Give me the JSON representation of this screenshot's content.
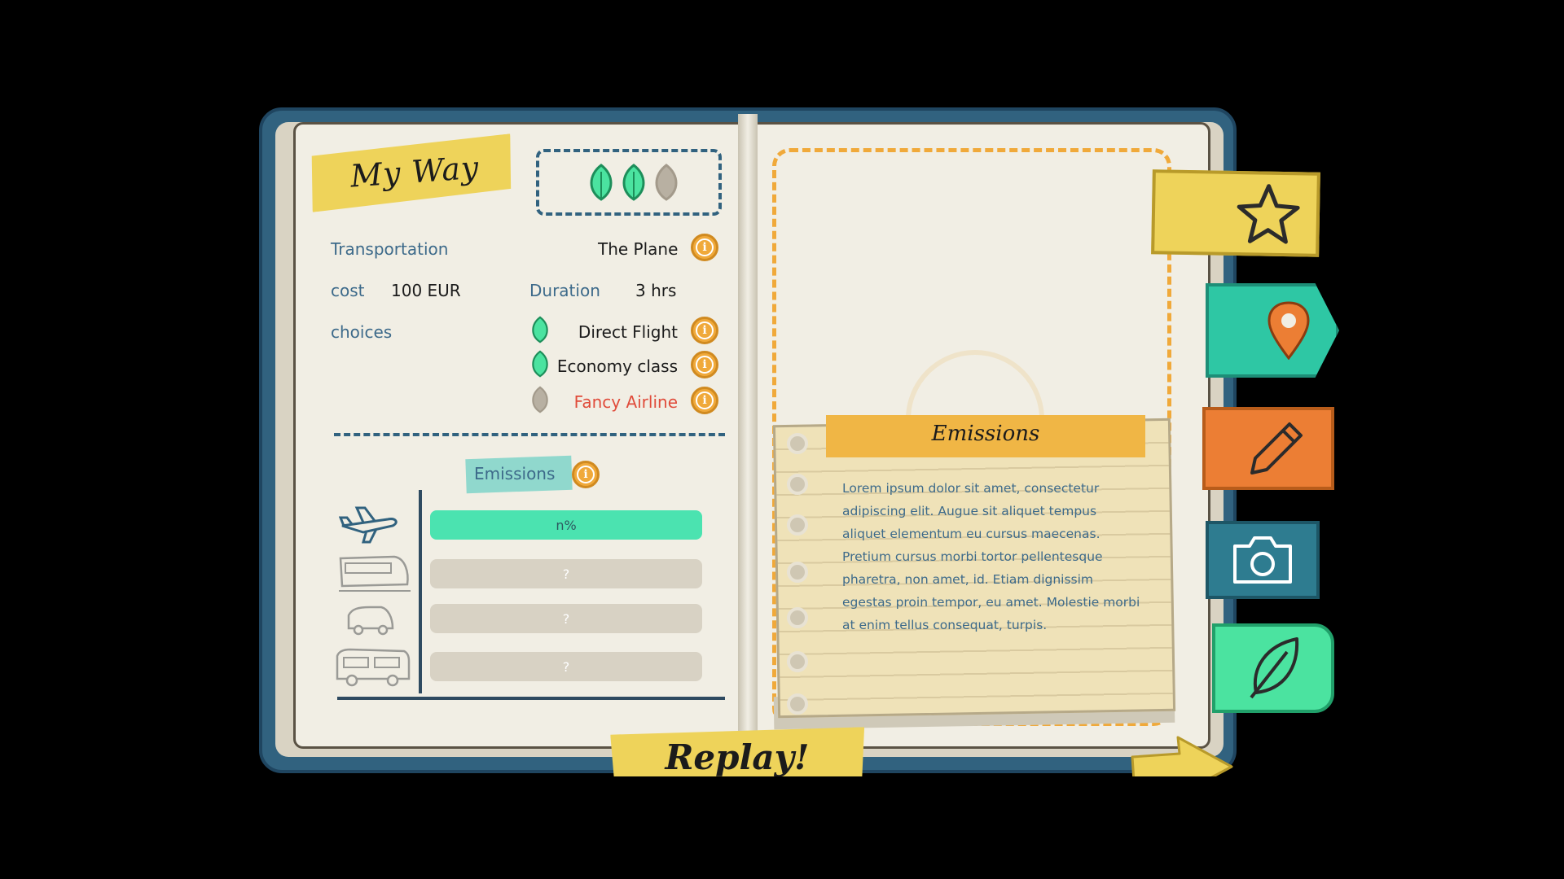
{
  "title": "My Way",
  "rating": {
    "green_leaves": 2,
    "grey_leaves": 1,
    "total": 3
  },
  "labels": {
    "transportation": "Transportation",
    "cost": "cost",
    "duration": "Duration",
    "choices": "choices"
  },
  "values": {
    "transportation": "The Plane",
    "cost": "100 EUR",
    "duration": "3 hrs"
  },
  "choices": [
    {
      "label": "Direct Flight",
      "eco": true,
      "color": "#1b1b1b"
    },
    {
      "label": "Economy class",
      "eco": true,
      "color": "#1b1b1b"
    },
    {
      "label": "Fancy Airline",
      "eco": false,
      "color": "#e04b3a"
    }
  ],
  "emissions_label": "Emissions",
  "bars": [
    {
      "vehicle": "plane-icon",
      "text": "n%",
      "state": "active"
    },
    {
      "vehicle": "train-icon",
      "text": "?",
      "state": "locked"
    },
    {
      "vehicle": "car-icon",
      "text": "?",
      "state": "locked"
    },
    {
      "vehicle": "camper-icon",
      "text": "?",
      "state": "locked"
    }
  ],
  "note": {
    "title": "Emissions",
    "body": "Lorem ipsum dolor sit amet, consectetur adipiscing elit. Augue sit aliquet tempus aliquet elementum eu cursus maecenas. Pretium cursus morbi tortor pellentesque pharetra, non amet, id. Etiam dignissim egestas proin tempor, eu amet. Molestie morbi at enim tellus consequat, turpis."
  },
  "tabs": [
    "star-icon",
    "map-pin-icon",
    "pencil-icon",
    "camera-icon",
    "leaf-icon"
  ],
  "replay": "Replay!",
  "colors": {
    "green": "#4be3a0",
    "teal": "#2ec7a4",
    "yellow": "#eed35a",
    "orange": "#ec7e34",
    "blue": "#31627f",
    "info": "#f0a93a"
  }
}
